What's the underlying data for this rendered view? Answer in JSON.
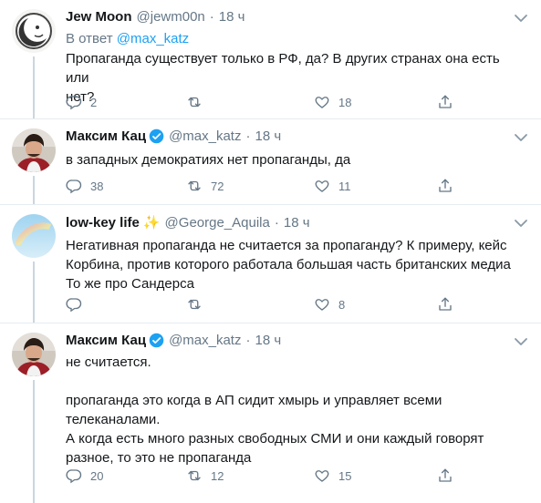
{
  "tweets": [
    {
      "name": "Jew Moon",
      "handle": "@jewm00n",
      "dot": "·",
      "time": "18 ч",
      "reply_prefix": "В ответ",
      "reply_mention": "@max_katz",
      "text": "Пропаганда существует только в РФ, да? В других странах она есть или\nнет?",
      "replies": "2",
      "retweets": "",
      "likes": "18"
    },
    {
      "name": "Максим Кац",
      "handle": "@max_katz",
      "dot": "·",
      "time": "18 ч",
      "text": "в западных демократиях нет пропаганды, да",
      "replies": "38",
      "retweets": "72",
      "likes": "11"
    },
    {
      "name": "low-key life",
      "sparkle": "✨",
      "handle": "@George_Aquila",
      "dot": "·",
      "time": "18 ч",
      "text": "Негативная пропаганда не считается за пропаганду? К примеру, кейс\nКорбина, против которого работала большая часть британских медиа\nТо же про Сандерса",
      "replies": "",
      "retweets": "",
      "likes": "8"
    },
    {
      "name": "Максим Кац",
      "handle": "@max_katz",
      "dot": "·",
      "time": "18 ч",
      "text": "не считается.\n\nпропаганда это когда в АП сидит хмырь и управляет всеми\nтелеканалами.\nА когда есть много разных свободных СМИ и они каждый говорят\nразное, то это не пропаганда",
      "replies": "20",
      "retweets": "12",
      "likes": "15"
    }
  ],
  "colors": {
    "accent": "#1da1f2",
    "secondary": "#657786",
    "divider": "#e6ecf0"
  },
  "icons": [
    "reply-icon",
    "retweet-icon",
    "like-icon",
    "share-icon",
    "chevron-down-icon",
    "verified-badge-icon"
  ]
}
